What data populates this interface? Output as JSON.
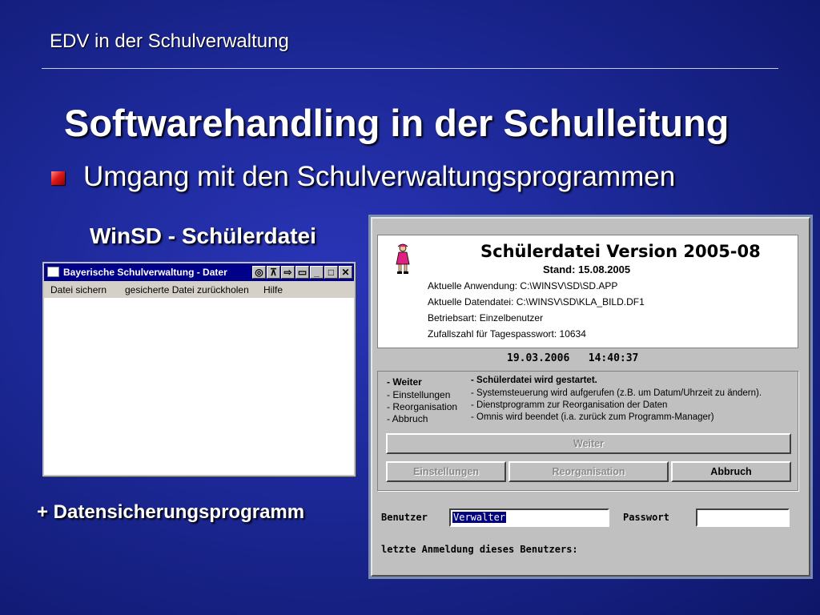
{
  "slide": {
    "header": "EDV in der Schulverwaltung",
    "title": "Softwarehandling in der Schulleitung",
    "bullet": "Umgang mit den Schulverwaltungsprogrammen",
    "left_label": "WinSD - Schülerdatei",
    "bottom_label": "+ Datensicherungsprogramm"
  },
  "small_window": {
    "title": "Bayerische Schulverwaltung - Dater",
    "menu": [
      "Datei sichern",
      "gesicherte Datei zurückholen",
      "Hilfe"
    ],
    "buttons": [
      "◎",
      "⊼",
      "⇨",
      "▭",
      "_",
      "□",
      "✕"
    ]
  },
  "dialog": {
    "title": "Schülerdatei Version 2005-08",
    "stand": "Stand: 15.08.2005",
    "lines": [
      "Aktuelle Anwendung: C:\\WINSV\\SD\\SD.APP",
      "Aktuelle Datendatei: C:\\WINSV\\SD\\KLA_BILD.DF1",
      "Betriebsart: Einzelbenutzer",
      "Zufallszahl für Tagespasswort: 10634"
    ],
    "date": "19.03.2006",
    "time": "14:40:37",
    "options": [
      {
        "key": "- Weiter",
        "desc": "- Schülerdatei wird gestartet."
      },
      {
        "key": "- Einstellungen",
        "desc": "- Systemsteuerung wird aufgerufen (z.B. um Datum/Uhrzeit zu ändern)."
      },
      {
        "key": "- Reorganisation",
        "desc": "- Dienstprogramm zur Reorganisation der Daten"
      },
      {
        "key": "- Abbruch",
        "desc": "- Omnis wird beendet (i.a. zurück zum Programm-Manager)"
      }
    ],
    "btn_weiter": "Weiter",
    "btn_einstellungen": "Einstellungen",
    "btn_reorganisation": "Reorganisation",
    "btn_abbruch": "Abbruch",
    "user_label": "Benutzer",
    "user_value": "Verwalter",
    "password_label": "Passwort",
    "password_value": "",
    "last_login_label": "letzte Anmeldung dieses Benutzers:"
  }
}
